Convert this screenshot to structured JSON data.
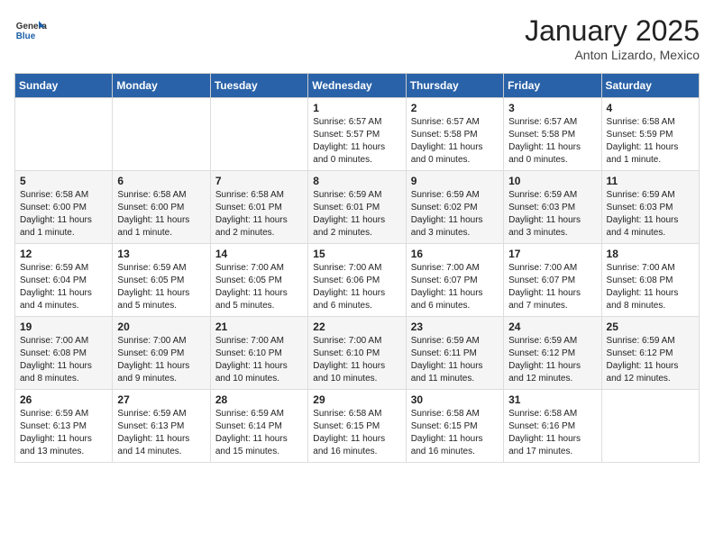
{
  "header": {
    "logo_general": "General",
    "logo_blue": "Blue",
    "month_title": "January 2025",
    "location": "Anton Lizardo, Mexico"
  },
  "weekdays": [
    "Sunday",
    "Monday",
    "Tuesday",
    "Wednesday",
    "Thursday",
    "Friday",
    "Saturday"
  ],
  "weeks": [
    [
      {
        "day": "",
        "info": ""
      },
      {
        "day": "",
        "info": ""
      },
      {
        "day": "",
        "info": ""
      },
      {
        "day": "1",
        "info": "Sunrise: 6:57 AM\nSunset: 5:57 PM\nDaylight: 11 hours and 0 minutes."
      },
      {
        "day": "2",
        "info": "Sunrise: 6:57 AM\nSunset: 5:58 PM\nDaylight: 11 hours and 0 minutes."
      },
      {
        "day": "3",
        "info": "Sunrise: 6:57 AM\nSunset: 5:58 PM\nDaylight: 11 hours and 0 minutes."
      },
      {
        "day": "4",
        "info": "Sunrise: 6:58 AM\nSunset: 5:59 PM\nDaylight: 11 hours and 1 minute."
      }
    ],
    [
      {
        "day": "5",
        "info": "Sunrise: 6:58 AM\nSunset: 6:00 PM\nDaylight: 11 hours and 1 minute."
      },
      {
        "day": "6",
        "info": "Sunrise: 6:58 AM\nSunset: 6:00 PM\nDaylight: 11 hours and 1 minute."
      },
      {
        "day": "7",
        "info": "Sunrise: 6:58 AM\nSunset: 6:01 PM\nDaylight: 11 hours and 2 minutes."
      },
      {
        "day": "8",
        "info": "Sunrise: 6:59 AM\nSunset: 6:01 PM\nDaylight: 11 hours and 2 minutes."
      },
      {
        "day": "9",
        "info": "Sunrise: 6:59 AM\nSunset: 6:02 PM\nDaylight: 11 hours and 3 minutes."
      },
      {
        "day": "10",
        "info": "Sunrise: 6:59 AM\nSunset: 6:03 PM\nDaylight: 11 hours and 3 minutes."
      },
      {
        "day": "11",
        "info": "Sunrise: 6:59 AM\nSunset: 6:03 PM\nDaylight: 11 hours and 4 minutes."
      }
    ],
    [
      {
        "day": "12",
        "info": "Sunrise: 6:59 AM\nSunset: 6:04 PM\nDaylight: 11 hours and 4 minutes."
      },
      {
        "day": "13",
        "info": "Sunrise: 6:59 AM\nSunset: 6:05 PM\nDaylight: 11 hours and 5 minutes."
      },
      {
        "day": "14",
        "info": "Sunrise: 7:00 AM\nSunset: 6:05 PM\nDaylight: 11 hours and 5 minutes."
      },
      {
        "day": "15",
        "info": "Sunrise: 7:00 AM\nSunset: 6:06 PM\nDaylight: 11 hours and 6 minutes."
      },
      {
        "day": "16",
        "info": "Sunrise: 7:00 AM\nSunset: 6:07 PM\nDaylight: 11 hours and 6 minutes."
      },
      {
        "day": "17",
        "info": "Sunrise: 7:00 AM\nSunset: 6:07 PM\nDaylight: 11 hours and 7 minutes."
      },
      {
        "day": "18",
        "info": "Sunrise: 7:00 AM\nSunset: 6:08 PM\nDaylight: 11 hours and 8 minutes."
      }
    ],
    [
      {
        "day": "19",
        "info": "Sunrise: 7:00 AM\nSunset: 6:08 PM\nDaylight: 11 hours and 8 minutes."
      },
      {
        "day": "20",
        "info": "Sunrise: 7:00 AM\nSunset: 6:09 PM\nDaylight: 11 hours and 9 minutes."
      },
      {
        "day": "21",
        "info": "Sunrise: 7:00 AM\nSunset: 6:10 PM\nDaylight: 11 hours and 10 minutes."
      },
      {
        "day": "22",
        "info": "Sunrise: 7:00 AM\nSunset: 6:10 PM\nDaylight: 11 hours and 10 minutes."
      },
      {
        "day": "23",
        "info": "Sunrise: 6:59 AM\nSunset: 6:11 PM\nDaylight: 11 hours and 11 minutes."
      },
      {
        "day": "24",
        "info": "Sunrise: 6:59 AM\nSunset: 6:12 PM\nDaylight: 11 hours and 12 minutes."
      },
      {
        "day": "25",
        "info": "Sunrise: 6:59 AM\nSunset: 6:12 PM\nDaylight: 11 hours and 12 minutes."
      }
    ],
    [
      {
        "day": "26",
        "info": "Sunrise: 6:59 AM\nSunset: 6:13 PM\nDaylight: 11 hours and 13 minutes."
      },
      {
        "day": "27",
        "info": "Sunrise: 6:59 AM\nSunset: 6:13 PM\nDaylight: 11 hours and 14 minutes."
      },
      {
        "day": "28",
        "info": "Sunrise: 6:59 AM\nSunset: 6:14 PM\nDaylight: 11 hours and 15 minutes."
      },
      {
        "day": "29",
        "info": "Sunrise: 6:58 AM\nSunset: 6:15 PM\nDaylight: 11 hours and 16 minutes."
      },
      {
        "day": "30",
        "info": "Sunrise: 6:58 AM\nSunset: 6:15 PM\nDaylight: 11 hours and 16 minutes."
      },
      {
        "day": "31",
        "info": "Sunrise: 6:58 AM\nSunset: 6:16 PM\nDaylight: 11 hours and 17 minutes."
      },
      {
        "day": "",
        "info": ""
      }
    ]
  ]
}
